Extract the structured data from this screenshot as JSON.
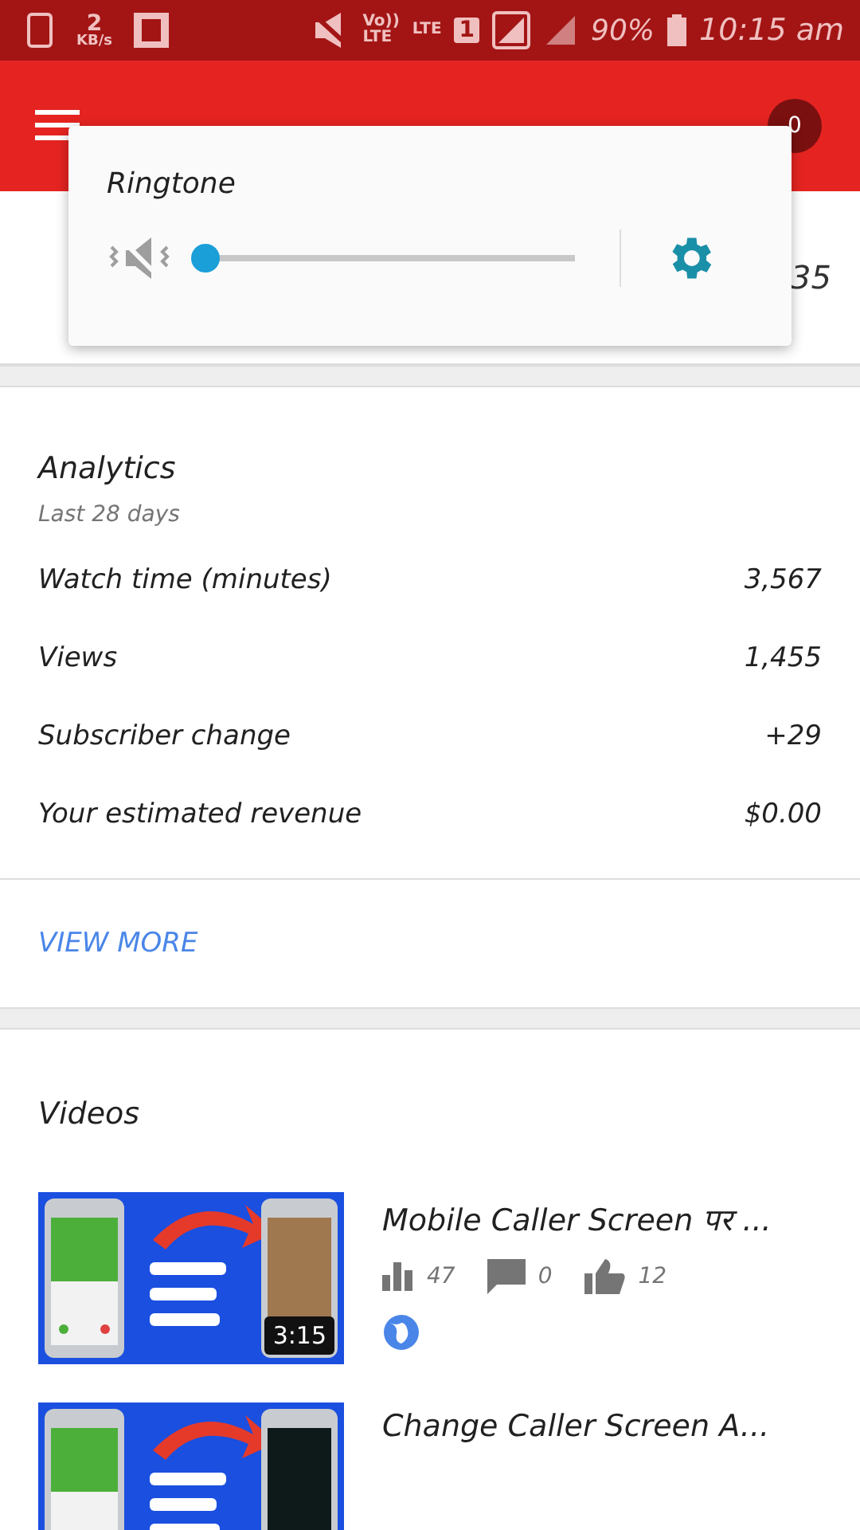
{
  "status_bar": {
    "speed": "2",
    "speed_unit": "KB/s",
    "volte_top": "Vo))",
    "volte_bottom": "LTE",
    "lte": "LTE",
    "sim": "1",
    "battery": "90%",
    "time": "10:15 am"
  },
  "app_bar": {
    "badge": "0"
  },
  "summary": {
    "side_number": "35"
  },
  "volume_popup": {
    "title": "Ringtone",
    "muted": true,
    "level": 0
  },
  "analytics": {
    "title": "Analytics",
    "subtitle": "Last 28 days",
    "rows": [
      {
        "label": "Watch time (minutes)",
        "value": "3,567"
      },
      {
        "label": "Views",
        "value": "1,455"
      },
      {
        "label": "Subscriber change",
        "value": "+29"
      },
      {
        "label": "Your estimated revenue",
        "value": "$0.00"
      }
    ],
    "link": "VIEW MORE"
  },
  "videos": {
    "title": "Videos",
    "items": [
      {
        "title": "Mobile Caller Screen पर ...",
        "duration": "3:15",
        "views": "47",
        "comments": "0",
        "likes": "12",
        "public": true
      },
      {
        "title": "Change Caller Screen A..."
      }
    ]
  }
}
